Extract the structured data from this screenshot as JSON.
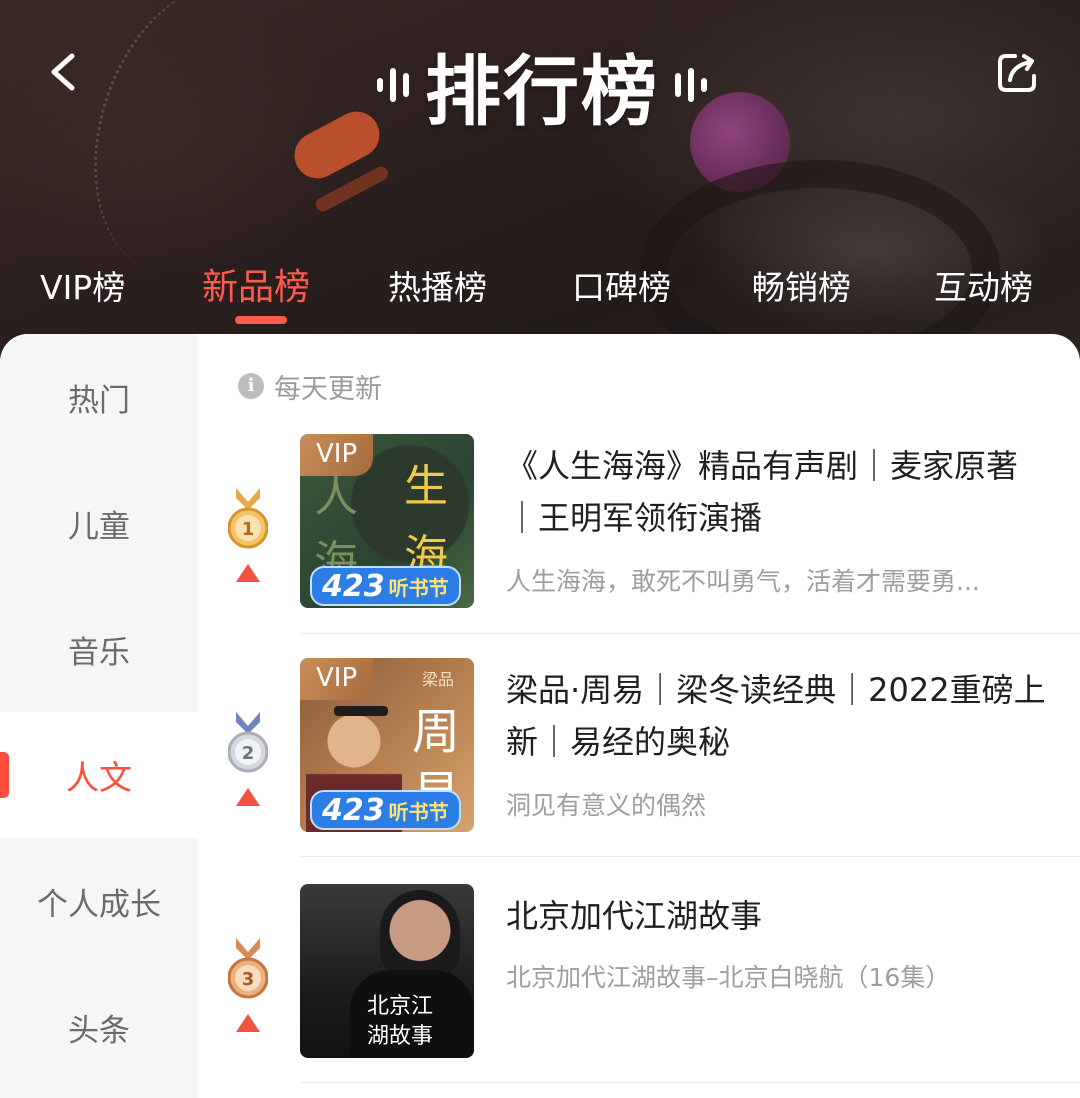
{
  "header": {
    "title": "排行榜",
    "tabs": [
      {
        "label": "VIP榜",
        "active": false
      },
      {
        "label": "新品榜",
        "active": true
      },
      {
        "label": "热播榜",
        "active": false
      },
      {
        "label": "口碑榜",
        "active": false
      },
      {
        "label": "畅销榜",
        "active": false
      },
      {
        "label": "互动榜",
        "active": false
      }
    ]
  },
  "sidebar": {
    "items": [
      {
        "label": "热门",
        "active": false
      },
      {
        "label": "儿童",
        "active": false
      },
      {
        "label": "音乐",
        "active": false
      },
      {
        "label": "人文",
        "active": true
      },
      {
        "label": "个人成长",
        "active": false
      },
      {
        "label": "头条",
        "active": false
      }
    ]
  },
  "list": {
    "update_note": "每天更新",
    "items": [
      {
        "rank": "1",
        "medal": "gold-medal",
        "trend": "up",
        "vip": "VIP",
        "festival_num": "423",
        "festival_text": "听书节",
        "cover_text": [
          "人",
          "生",
          "海",
          "海"
        ],
        "title": "《人生海海》精品有声剧｜麦家原著｜王明军领衔演播",
        "desc": "人生海海，敢死不叫勇气，活着才需要勇..."
      },
      {
        "rank": "2",
        "medal": "silver-medal",
        "trend": "up",
        "vip": "VIP",
        "festival_num": "423",
        "festival_text": "听书节",
        "cover_text": [
          "梁品",
          "周",
          "易"
        ],
        "title": "梁品·周易｜梁冬读经典｜2022重磅上新｜易经的奥秘",
        "desc": "洞见有意义的偶然"
      },
      {
        "rank": "3",
        "medal": "bronze-medal",
        "trend": "up",
        "cover_text": [
          "北京江",
          "湖故事"
        ],
        "title": "北京加代江湖故事",
        "desc": "北京加代江湖故事–北京白晓航（16集）"
      }
    ]
  },
  "colors": {
    "accent": "#ff5b4d",
    "gold": "#e7a84a",
    "silver": "#a9adb5",
    "bronze": "#d98a55",
    "festival_blue": "#2d7de6"
  }
}
